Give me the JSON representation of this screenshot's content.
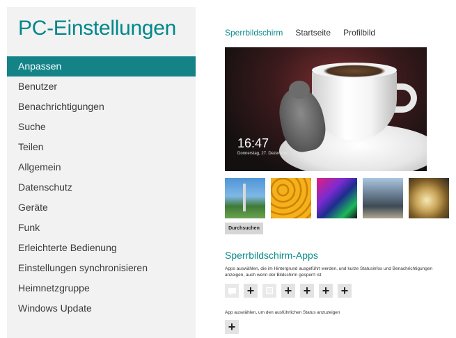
{
  "app": {
    "title": "PC-Einstellungen"
  },
  "nav": {
    "items": [
      {
        "label": "Anpassen"
      },
      {
        "label": "Benutzer"
      },
      {
        "label": "Benachrichtigungen"
      },
      {
        "label": "Suche"
      },
      {
        "label": "Teilen"
      },
      {
        "label": "Allgemein"
      },
      {
        "label": "Datenschutz"
      },
      {
        "label": "Geräte"
      },
      {
        "label": "Funk"
      },
      {
        "label": "Erleichterte Bedienung"
      },
      {
        "label": "Einstellungen synchronisieren"
      },
      {
        "label": "Heimnetzgruppe"
      },
      {
        "label": "Windows Update"
      }
    ],
    "selected": "Anpassen"
  },
  "tabs": [
    {
      "label": "Sperrbildschirm"
    },
    {
      "label": "Startseite"
    },
    {
      "label": "Profilbild"
    }
  ],
  "preview": {
    "time": "16:47",
    "date": "Donnerstag, 27. Dezember"
  },
  "thumbnails": [
    "space-needle-thumbnail",
    "honeycomb-thumbnail",
    "abstract-color-thumbnail",
    "train-station-thumbnail",
    "nautilus-shell-thumbnail"
  ],
  "browse_label": "Durchsuchen",
  "lock_apps": {
    "title": "Sperrbildschirm-Apps",
    "description": "Apps auswählen, die im Hintergrund ausgeführt werden, und kurze Statusinfos und Benachrichtigungen anzeigen, auch wenn der Bildschirm gesperrt ist",
    "slots": [
      "message-icon",
      "plus-icon",
      "calendar-icon",
      "plus-icon",
      "plus-icon",
      "plus-icon",
      "plus-icon"
    ],
    "detailed_description": "App auswählen, um den ausführlichen Status anzuzeigen",
    "detailed_slot": "plus-icon"
  },
  "colors": {
    "accent": "#148388",
    "accent_text": "#0b8b8b",
    "sidebar_bg": "#f2f2f2"
  }
}
